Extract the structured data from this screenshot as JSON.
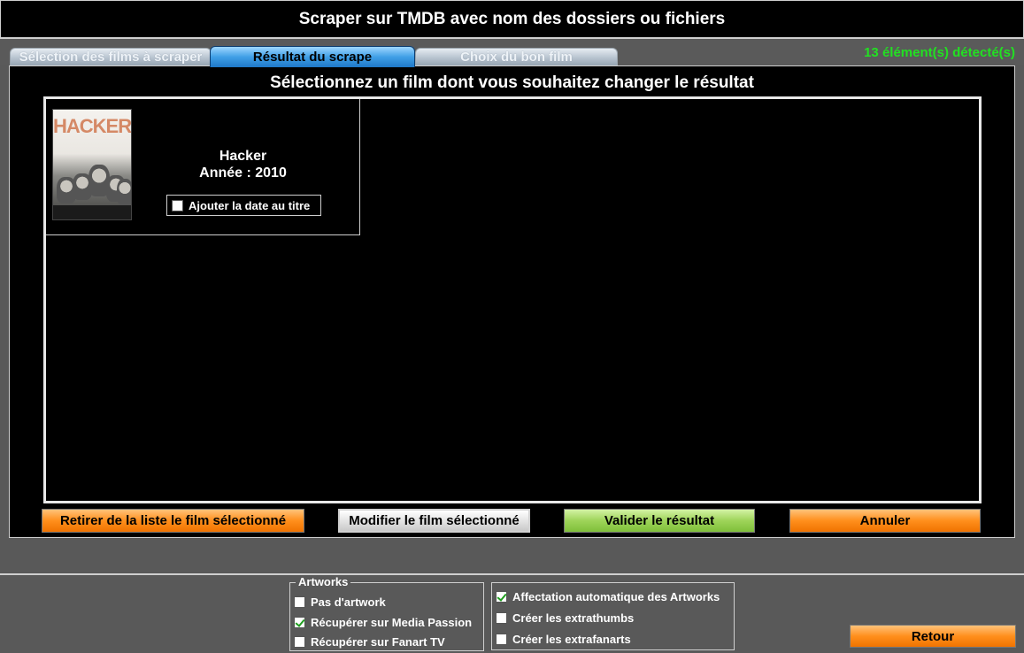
{
  "window": {
    "title": "Scraper sur TMDB avec nom des dossiers ou fichiers",
    "detected_count": "13 élément(s) détecté(s)"
  },
  "tabs": [
    {
      "label": "Sélection des films à scraper",
      "active": false
    },
    {
      "label": "Résultat du scrape",
      "active": true
    },
    {
      "label": "Choix du bon film",
      "active": false
    }
  ],
  "panel": {
    "heading": "Sélectionnez un film dont vous souhaitez changer le résultat"
  },
  "film": {
    "poster_title": "HACKER",
    "title": "Hacker",
    "year": "Année : 2010",
    "add_date_label": "Ajouter la date au titre",
    "add_date_checked": false
  },
  "actions": {
    "remove": "Retirer de la liste le film sélectionné",
    "modify": "Modifier le film sélectionné",
    "validate": "Valider le résultat",
    "cancel": "Annuler"
  },
  "artworks": {
    "legend": "Artworks",
    "options": [
      {
        "label": "Pas d'artwork",
        "checked": false
      },
      {
        "label": "Récupérer sur Media Passion",
        "checked": true
      },
      {
        "label": "Récupérer sur Fanart TV",
        "checked": false
      }
    ]
  },
  "extras": [
    {
      "label": "Affectation automatique des Artworks",
      "checked": true
    },
    {
      "label": "Créer les extrathumbs",
      "checked": false
    },
    {
      "label": "Créer les extrafanarts",
      "checked": false
    }
  ],
  "footer": {
    "back": "Retour"
  },
  "colors": {
    "count_text": "#22e022",
    "orange_button": "#ff8f1c",
    "green_button": "#9ed459",
    "active_tab": "#3f9fe6"
  }
}
